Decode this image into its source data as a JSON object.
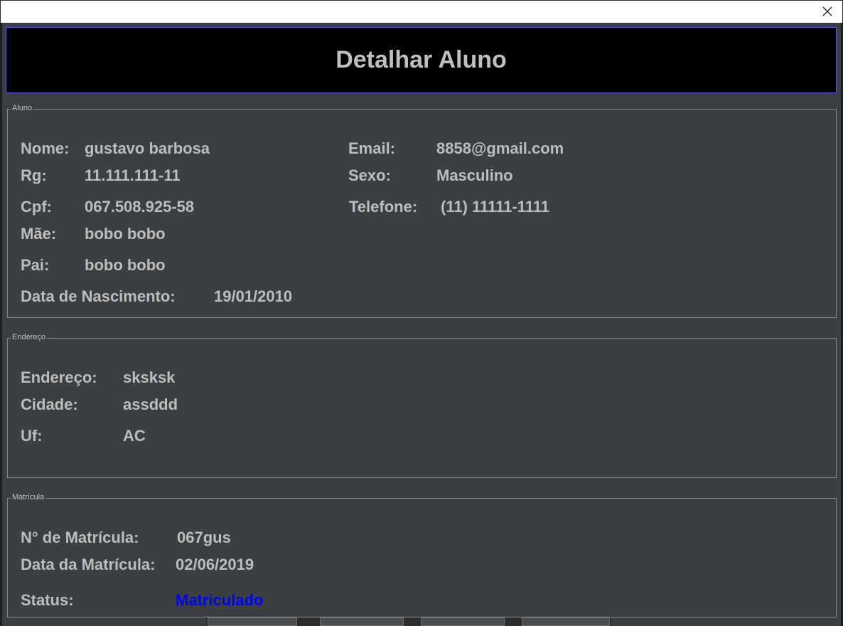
{
  "window": {
    "close_icon": "close-icon"
  },
  "header": {
    "title": "Detalhar Aluno"
  },
  "aluno": {
    "legend": "Aluno",
    "nome_label": "Nome:",
    "nome_value": "gustavo barbosa",
    "rg_label": "Rg:",
    "rg_value": "11.111.111-11",
    "cpf_label": "Cpf:",
    "cpf_value": "067.508.925-58",
    "mae_label": "Mãe:",
    "mae_value": "bobo bobo",
    "pai_label": "Pai:",
    "pai_value": "bobo bobo",
    "nascimento_label": "Data de Nascimento:",
    "nascimento_value": "19/01/2010",
    "email_label": "Email:",
    "email_value": "8858@gmail.com",
    "sexo_label": "Sexo:",
    "sexo_value": "Masculino",
    "telefone_label": "Telefone:",
    "telefone_value": "(11) 11111-1111"
  },
  "endereco": {
    "legend": "Endereço",
    "endereco_label": "Endereço:",
    "endereco_value": "sksksk",
    "cidade_label": "Cidade:",
    "cidade_value": "assddd",
    "uf_label": "Uf:",
    "uf_value": "AC"
  },
  "matricula": {
    "legend": "Matrícula",
    "numero_label": "N° de Matrícula:",
    "numero_value": "067gus",
    "data_label": "Data da Matrícula:",
    "data_value": "02/06/2019",
    "status_label": "Status:",
    "status_value": "Matriculado",
    "status_color": "#0000ff"
  }
}
